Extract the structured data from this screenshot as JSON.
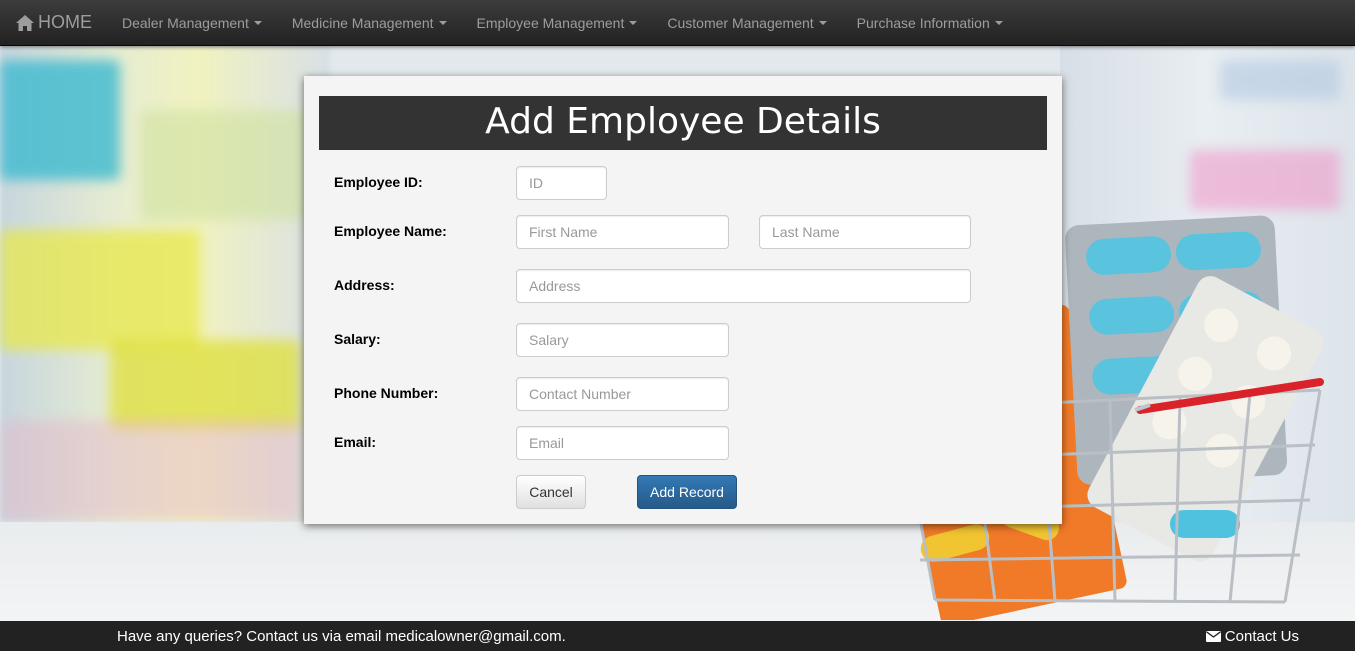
{
  "navbar": {
    "brand": "HOME",
    "items": [
      {
        "label": "Dealer Management"
      },
      {
        "label": "Medicine Management"
      },
      {
        "label": "Employee Management"
      },
      {
        "label": "Customer Management"
      },
      {
        "label": "Purchase Information"
      }
    ]
  },
  "form": {
    "title": "Add Employee Details",
    "employee_id": {
      "label": "Employee ID:",
      "placeholder": "ID"
    },
    "employee_name": {
      "label": "Employee Name:",
      "first_placeholder": "First Name",
      "last_placeholder": "Last Name"
    },
    "address": {
      "label": "Address:",
      "placeholder": "Address"
    },
    "salary": {
      "label": "Salary:",
      "placeholder": "Salary"
    },
    "phone": {
      "label": "Phone Number:",
      "placeholder": "Contact Number"
    },
    "email": {
      "label": "Email:",
      "placeholder": "Email"
    },
    "cancel_label": "Cancel",
    "submit_label": "Add Record"
  },
  "footer": {
    "text": "Have any queries? Contact us via email medicalowner@gmail.com.",
    "contact_label": "Contact Us"
  },
  "icons": {
    "home": "home-icon",
    "envelope": "envelope-icon"
  },
  "colors": {
    "navbar": "#222222",
    "title_bar": "#333333",
    "primary_button": "#337ab7"
  }
}
